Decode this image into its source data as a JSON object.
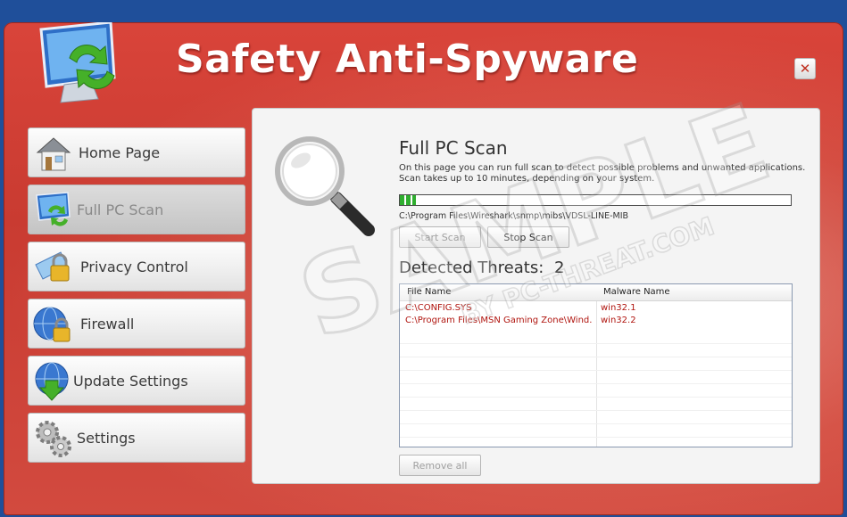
{
  "app": {
    "title": "Safety Anti-Spyware",
    "close_label": "✕"
  },
  "nav": {
    "items": [
      {
        "label": "Home Page",
        "icon": "house-icon"
      },
      {
        "label": "Full PC Scan",
        "icon": "monitor-refresh-icon",
        "active": true
      },
      {
        "label": "Privacy Control",
        "icon": "lock-globe-icon"
      },
      {
        "label": "Firewall",
        "icon": "firewall-globe-lock-icon"
      },
      {
        "label": "Update Settings",
        "icon": "globe-download-icon"
      },
      {
        "label": "Settings",
        "icon": "gears-icon"
      }
    ]
  },
  "scan": {
    "title": "Full PC Scan",
    "description_line1": "On this page you can run full scan to detect possible problems and unwanted applications.",
    "description_line2": "Scan takes up to 10 minutes, depending on your system.",
    "progress_fraction": 0.04,
    "current_path": "C:\\Program Files\\Wireshark\\snmp\\mibs\\VDSL-LINE-MIB",
    "start_label": "Start Scan",
    "stop_label": "Stop Scan"
  },
  "threats": {
    "label": "Detected Threats:",
    "count": "2",
    "columns": [
      "File Name",
      "Malware Name"
    ],
    "rows": [
      {
        "file": "C:\\CONFIG.SYS",
        "malware": "win32.1"
      },
      {
        "file": "C:\\Program Files\\MSN Gaming Zone\\Wind...",
        "malware": "win32.2"
      }
    ],
    "remove_label": "Remove all"
  },
  "watermark": {
    "main": "SAMPLE",
    "sub": "BY PC-THREAT.COM"
  },
  "colors": {
    "window_red": "#d9443a",
    "progress_green": "#2fae2f",
    "threat_red": "#b0150f"
  }
}
